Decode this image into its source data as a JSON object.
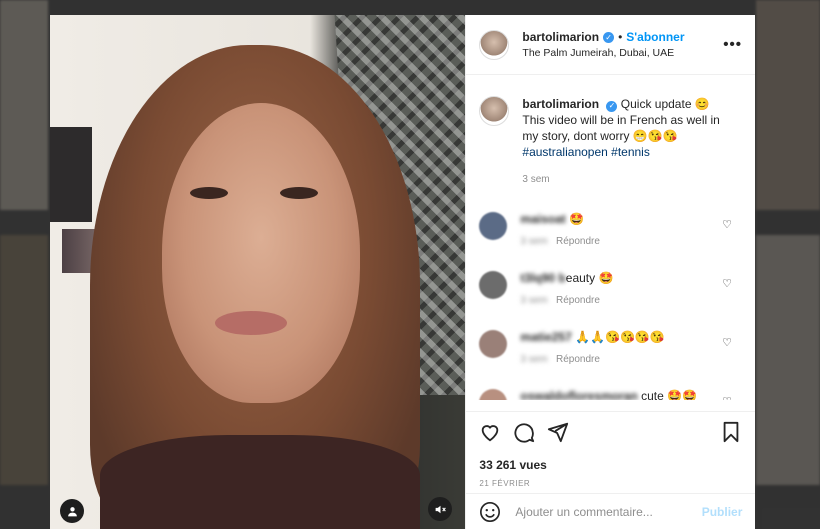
{
  "post": {
    "username": "bartolimarion",
    "follow_label": "S'abonner",
    "separator": "•",
    "location": "The Palm Jumeirah, Dubai, UAE",
    "more_label": "•••"
  },
  "caption": {
    "username": "bartolimarion",
    "line1": "Quick update 😊",
    "line2": "This video will be in French as well in",
    "line3": "my story, dont worry 😁😘😘",
    "tags": "#australianopen #tennis",
    "time": "3 sem"
  },
  "comments": [
    {
      "user": "maisoat",
      "text": "🤩",
      "time": "3 sem",
      "reply": "Répondre",
      "avatar_color": "#5b6b86"
    },
    {
      "user": "t3lq90 b",
      "text": "eauty 🤩",
      "time": "3 sem",
      "reply": "Répondre",
      "avatar_color": "#6c6c6c"
    },
    {
      "user": "matie257",
      "text": "🙏🙏😘😘😘😘",
      "time": "3 sem",
      "reply": "Répondre",
      "avatar_color": "#9a8078"
    },
    {
      "user": "oswaldofloresmoran",
      "text": "cute 🤩🤩",
      "time": "",
      "reply": "",
      "avatar_color": "#b89080"
    }
  ],
  "actions": {
    "views": "33 261 vues",
    "date": "21 FÉVRIER"
  },
  "add_comment": {
    "placeholder": "Ajouter un commentaire...",
    "publish_label": "Publier"
  },
  "icons": {
    "like": "heart-icon",
    "comment": "comment-icon",
    "share": "share-icon",
    "save": "bookmark-icon",
    "emoji": "emoji-icon",
    "user_tag": "user-icon",
    "mute": "mute-icon"
  },
  "colors": {
    "accent": "#0095f6",
    "verified": "#3897f0",
    "publish_disabled": "#b2dffc"
  }
}
